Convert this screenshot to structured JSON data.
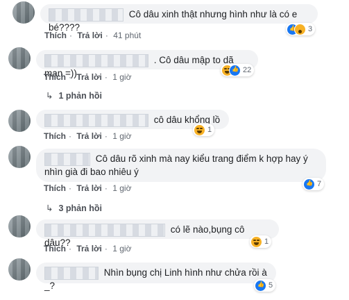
{
  "labels": {
    "like": "Thích",
    "reply": "Trả lời"
  },
  "comments": [
    {
      "text": "Cô dâu xinh thật nhưng hình như là có e bé????",
      "time": "41 phút",
      "reaction_count": "3",
      "reactions": [
        "like",
        "wow"
      ]
    },
    {
      "text": ". Cô dâu mập to dã man =))",
      "time": "1 giờ",
      "reaction_count": "22",
      "reactions": [
        "haha",
        "like"
      ],
      "replies": "1 phản hồi"
    },
    {
      "text": "cô dâu khổng lồ",
      "time": "1 giờ",
      "reaction_count": "1",
      "reactions": [
        "haha"
      ]
    },
    {
      "text": "Cô dâu rõ xinh mà nay kiểu trang điểm k hợp hay ý nhìn già đi bao nhiêu ý",
      "time": "1 giờ",
      "reaction_count": "7",
      "reactions": [
        "like"
      ],
      "replies": "3 phản hồi"
    },
    {
      "text": "có lẽ nào,bụng cô dâu??",
      "time": "1 giờ",
      "reaction_count": "1",
      "reactions": [
        "haha"
      ]
    },
    {
      "text": "Nhìn bụng chị Linh hình như chửa rồi à _?",
      "reaction_count": "5",
      "reactions": [
        "like"
      ]
    }
  ]
}
